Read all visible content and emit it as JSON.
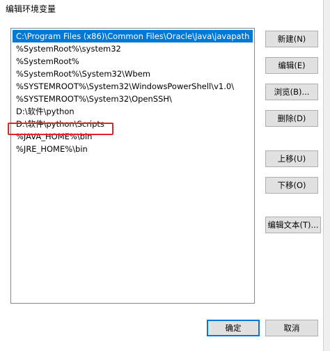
{
  "window": {
    "title": "编辑环境变量"
  },
  "list": {
    "items": [
      {
        "text": "C:\\Program Files (x86)\\Common Files\\Oracle\\Java\\javapath",
        "selected": true
      },
      {
        "text": "%SystemRoot%\\system32",
        "selected": false
      },
      {
        "text": "%SystemRoot%",
        "selected": false
      },
      {
        "text": "%SystemRoot%\\System32\\Wbem",
        "selected": false
      },
      {
        "text": "%SYSTEMROOT%\\System32\\WindowsPowerShell\\v1.0\\",
        "selected": false
      },
      {
        "text": "%SYSTEMROOT%\\System32\\OpenSSH\\",
        "selected": false
      },
      {
        "text": "D:\\软件\\python",
        "selected": false
      },
      {
        "text": "D:\\软件\\python\\Scripts",
        "selected": false
      },
      {
        "text": "%JAVA_HOME%\\bin",
        "selected": false
      },
      {
        "text": "%JRE_HOME%\\bin",
        "selected": false
      }
    ],
    "selected_color": "#0078d7",
    "highlight_color": "#e2232a"
  },
  "buttons": {
    "new": "新建(N)",
    "edit": "编辑(E)",
    "browse": "浏览(B)...",
    "delete": "删除(D)",
    "move_up": "上移(U)",
    "move_down": "下移(O)",
    "edit_text": "编辑文本(T)...",
    "ok": "确定",
    "cancel": "取消"
  }
}
